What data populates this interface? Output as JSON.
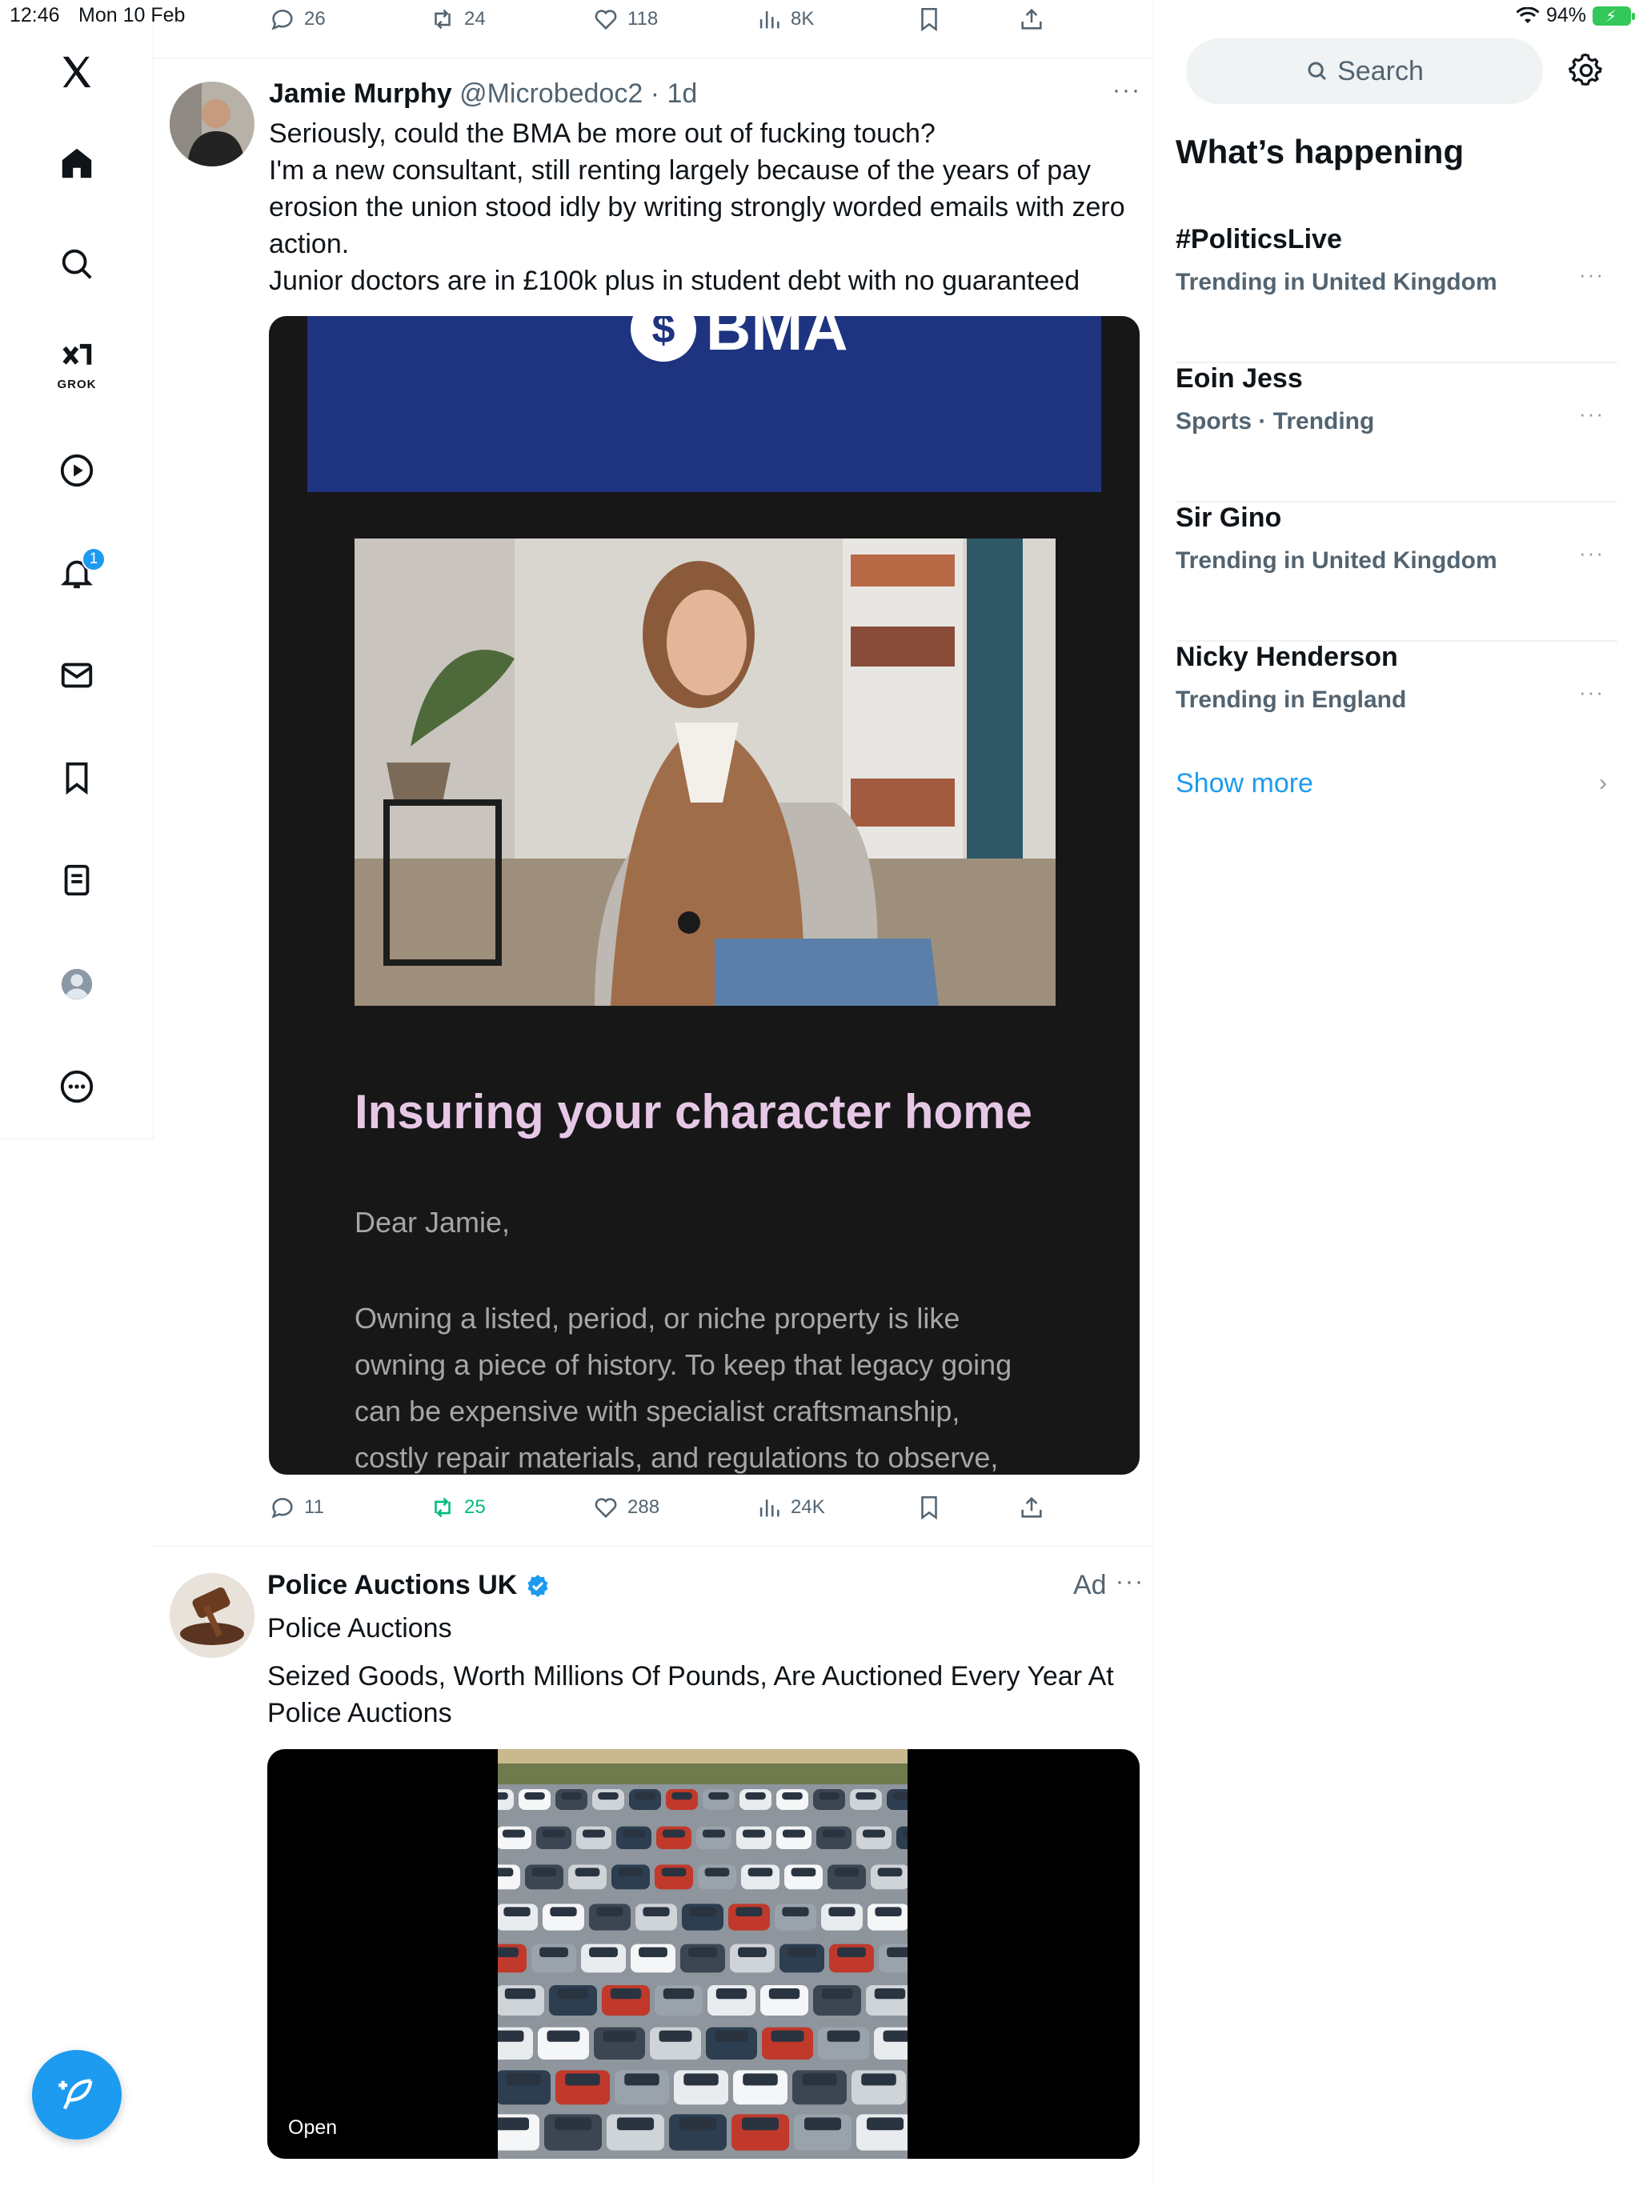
{
  "status_bar": {
    "time": "12:46",
    "date": "Mon 10 Feb",
    "battery": "94%"
  },
  "nav": {
    "items": [
      "x-logo",
      "home",
      "explore",
      "grok",
      "video",
      "notifications",
      "messages",
      "bookmarks",
      "lists",
      "profile",
      "more"
    ],
    "grok_label": "GROK",
    "notification_count": "1"
  },
  "prev_tweet_actions": {
    "replies": "26",
    "reposts": "24",
    "likes": "118",
    "views": "8K"
  },
  "tweet": {
    "name": "Jamie Murphy",
    "handle": "@Microbedoc2",
    "time": "· 1d",
    "lines": [
      "Seriously, could the BMA be more out of fucking touch?",
      "I'm a new consultant, still renting largely because of the years of pay",
      "erosion the union stood idly by writing strongly worded emails with zero",
      "action.",
      "Junior doctors are in £100k plus in student debt with no guaranteed"
    ],
    "card": {
      "brand": "BMA",
      "title": "Insuring your character home",
      "greeting": "Dear Jamie,",
      "body_lines": [
        "Owning a listed, period, or niche property is like",
        "owning a piece of history. To keep that legacy going",
        "can be expensive with specialist craftsmanship,",
        "costly repair materials, and regulations to observe,"
      ]
    },
    "actions": {
      "replies": "11",
      "reposts": "25",
      "likes": "288",
      "views": "24K"
    }
  },
  "ad": {
    "name": "Police Auctions UK",
    "ad_label": "Ad",
    "subtitle": "Police Auctions",
    "lines": [
      "Seized Goods, Worth Millions Of Pounds, Are Auctioned Every Year At",
      "Police Auctions"
    ],
    "open_label": "Open"
  },
  "sidebar": {
    "search_placeholder": "Search",
    "title": "What’s happening",
    "trends": [
      {
        "name": "#PoliticsLive",
        "meta": "Trending in United Kingdom"
      },
      {
        "name": "Eoin Jess",
        "meta": "Sports · Trending"
      },
      {
        "name": "Sir Gino",
        "meta": "Trending in United Kingdom"
      },
      {
        "name": "Nicky Henderson",
        "meta": "Trending in England"
      }
    ],
    "show_more": "Show more"
  },
  "colors": {
    "accent": "#1d9bf0",
    "repost_active": "#00ba7c",
    "bma_blue": "#1e3480",
    "text_secondary": "#536471"
  }
}
